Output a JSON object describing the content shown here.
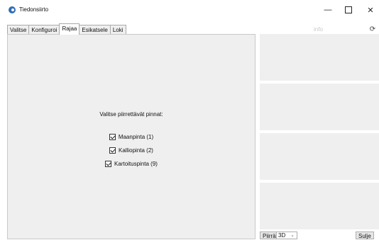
{
  "window": {
    "title": "Tiedonsiirto",
    "minimize_glyph": "—",
    "close_glyph": "✕"
  },
  "tabs": [
    {
      "label": "Valitse",
      "active": false
    },
    {
      "label": "Konfiguroi",
      "active": false
    },
    {
      "label": "Rajaa",
      "active": true
    },
    {
      "label": "Esikatsele",
      "active": false
    },
    {
      "label": "Loki",
      "active": false
    }
  ],
  "main": {
    "prompt": "Valitse piirrettävät pinnat:",
    "checkboxes": [
      {
        "label": "Maanpinta (1)",
        "checked": true
      },
      {
        "label": "Kalliopinta (2)",
        "checked": true
      },
      {
        "label": "Kartoituspinta (9)",
        "checked": true
      }
    ]
  },
  "right": {
    "info_label": "info",
    "refresh_icon": "⟳"
  },
  "bottom": {
    "draw_button": "Piirrä",
    "view_mode": "3D",
    "close_button": "Sulje"
  },
  "colors": {
    "panel_bg": "#efefef",
    "app_icon": "#2f6fb5"
  }
}
